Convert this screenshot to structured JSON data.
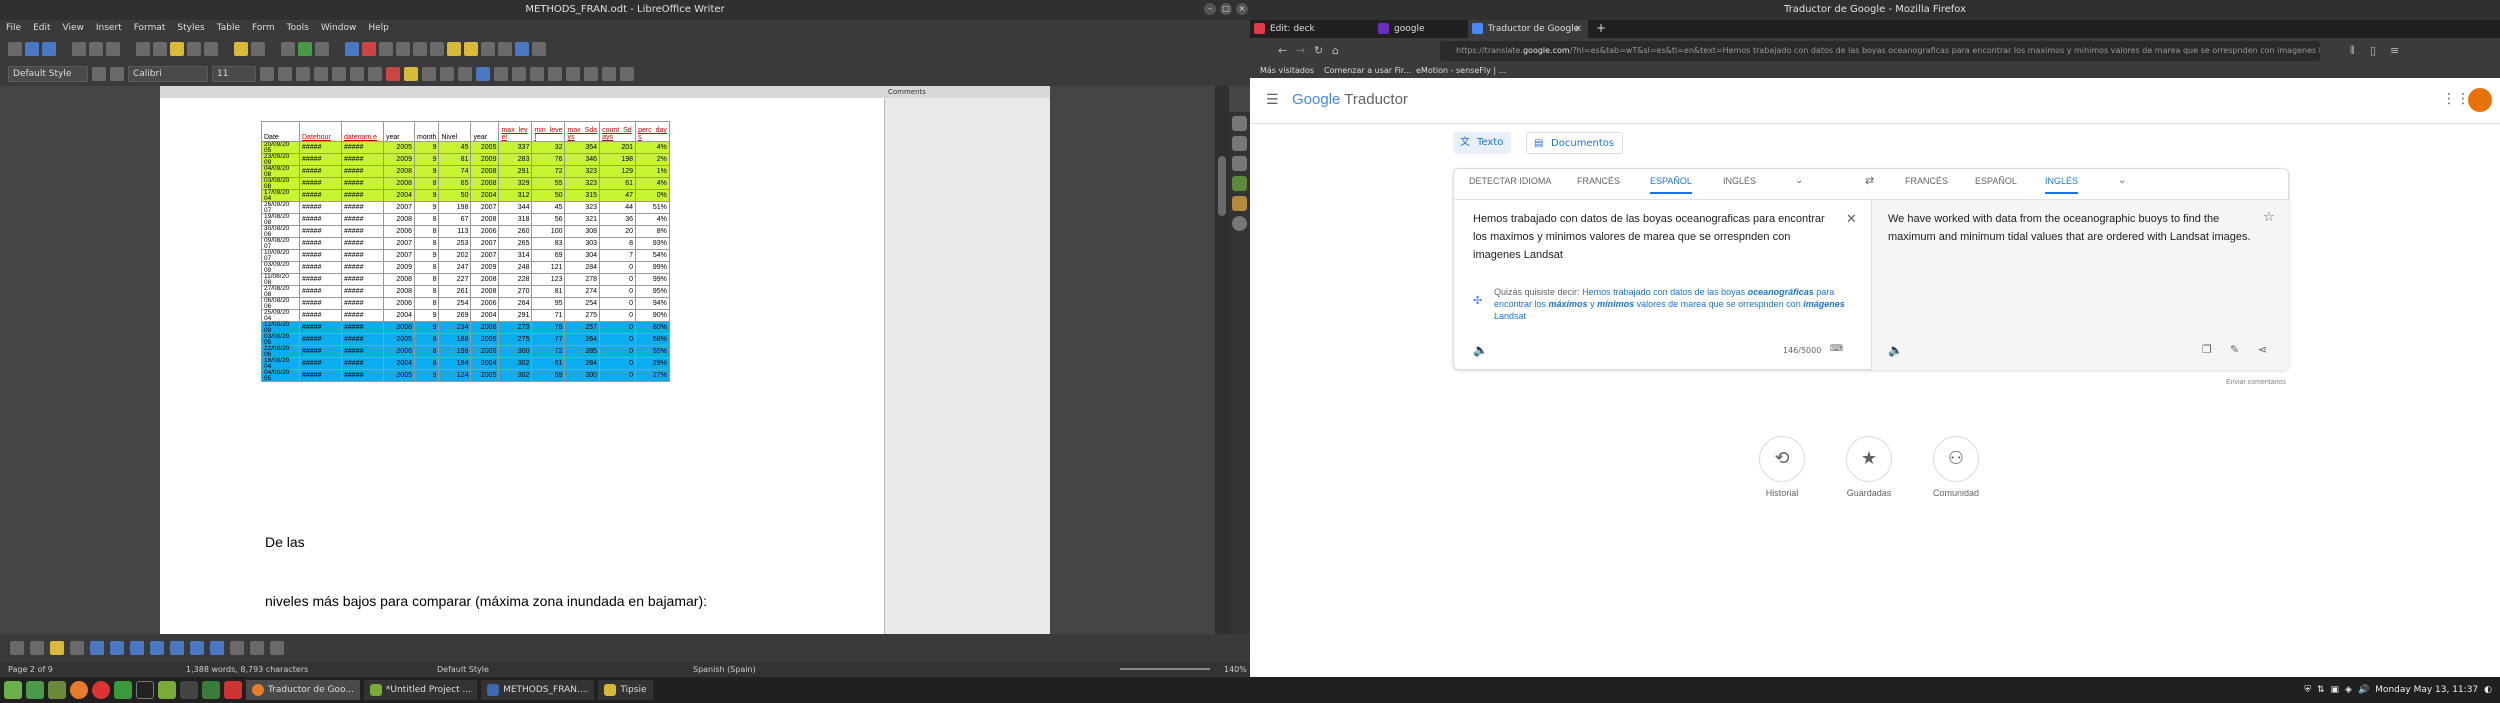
{
  "writer": {
    "title": "METHODS_FRAN.odt - LibreOffice Writer",
    "menu": [
      "File",
      "Edit",
      "View",
      "Insert",
      "Format",
      "Styles",
      "Table",
      "Form",
      "Tools",
      "Window",
      "Help"
    ],
    "para_style": "Default Style",
    "font": "Calibri",
    "size": "11",
    "comments_label": "Comments",
    "table": {
      "headers": [
        "Date",
        "Datehour",
        "datenam e",
        "year",
        "month",
        "Nivel",
        "year",
        "max_lev el",
        "min_leve l",
        "max_Sda ys",
        "count_Sd ays",
        "perc_day s"
      ],
      "header_links": [
        false,
        true,
        true,
        false,
        false,
        false,
        false,
        true,
        true,
        true,
        true,
        true
      ],
      "rows": [
        {
          "c": "g",
          "v": [
            "20/09/20 05",
            "#####",
            "#####",
            "2005",
            "9",
            "45",
            "2005",
            "337",
            "32",
            "354",
            "201",
            "4%"
          ]
        },
        {
          "c": "g",
          "v": [
            "23/09/20 09",
            "#####",
            "#####",
            "2009",
            "9",
            "81",
            "2009",
            "283",
            "76",
            "346",
            "198",
            "2%"
          ]
        },
        {
          "c": "g",
          "v": [
            "04/09/20 08",
            "#####",
            "#####",
            "2008",
            "9",
            "74",
            "2008",
            "291",
            "72",
            "323",
            "129",
            "1%"
          ]
        },
        {
          "c": "g",
          "v": [
            "03/08/20 08",
            "#####",
            "#####",
            "2008",
            "8",
            "65",
            "2008",
            "329",
            "55",
            "323",
            "61",
            "4%"
          ]
        },
        {
          "c": "g",
          "v": [
            "17/09/20 04",
            "#####",
            "#####",
            "2004",
            "9",
            "50",
            "2004",
            "312",
            "50",
            "315",
            "47",
            "0%"
          ]
        },
        {
          "c": "w",
          "v": [
            "26/09/20 07",
            "#####",
            "#####",
            "2007",
            "9",
            "198",
            "2007",
            "344",
            "45",
            "323",
            "44",
            "51%"
          ]
        },
        {
          "c": "w",
          "v": [
            "19/08/20 08",
            "#####",
            "#####",
            "2008",
            "8",
            "67",
            "2008",
            "318",
            "56",
            "321",
            "36",
            "4%"
          ]
        },
        {
          "c": "w",
          "v": [
            "30/08/20 06",
            "#####",
            "#####",
            "2006",
            "8",
            "113",
            "2006",
            "260",
            "100",
            "308",
            "20",
            "8%"
          ]
        },
        {
          "c": "w",
          "v": [
            "09/08/20 07",
            "#####",
            "#####",
            "2007",
            "8",
            "253",
            "2007",
            "265",
            "83",
            "303",
            "8",
            "93%"
          ]
        },
        {
          "c": "w",
          "v": [
            "10/09/20 07",
            "#####",
            "#####",
            "2007",
            "9",
            "202",
            "2007",
            "314",
            "69",
            "304",
            "7",
            "54%"
          ]
        },
        {
          "c": "w",
          "v": [
            "03/09/20 09",
            "#####",
            "#####",
            "2009",
            "8",
            "247",
            "2009",
            "248",
            "121",
            "284",
            "0",
            "99%"
          ]
        },
        {
          "c": "w",
          "v": [
            "11/08/20 08",
            "#####",
            "#####",
            "2008",
            "8",
            "227",
            "2008",
            "228",
            "123",
            "278",
            "0",
            "99%"
          ]
        },
        {
          "c": "w",
          "v": [
            "27/08/20 08",
            "#####",
            "#####",
            "2008",
            "8",
            "261",
            "2008",
            "270",
            "81",
            "274",
            "0",
            "95%"
          ]
        },
        {
          "c": "w",
          "v": [
            "06/08/20 06",
            "#####",
            "#####",
            "2006",
            "8",
            "254",
            "2006",
            "264",
            "95",
            "254",
            "0",
            "94%"
          ]
        },
        {
          "c": "w",
          "v": [
            "25/09/20 04",
            "#####",
            "#####",
            "2004",
            "9",
            "269",
            "2004",
            "291",
            "71",
            "275",
            "0",
            "90%"
          ]
        },
        {
          "c": "b",
          "v": [
            "12/09/20 08",
            "#####",
            "#####",
            "2008",
            "9",
            "234",
            "2008",
            "273",
            "75",
            "257",
            "0",
            "80%"
          ]
        },
        {
          "c": "b",
          "v": [
            "03/08/20 05",
            "#####",
            "#####",
            "2005",
            "8",
            "188",
            "2005",
            "275",
            "77",
            "264",
            "0",
            "58%"
          ]
        },
        {
          "c": "b",
          "v": [
            "22/08/20 06",
            "#####",
            "#####",
            "2006",
            "8",
            "198",
            "2006",
            "300",
            "72",
            "285",
            "0",
            "55%"
          ]
        },
        {
          "c": "b",
          "v": [
            "18/08/20 04",
            "#####",
            "#####",
            "2004",
            "8",
            "194",
            "2004",
            "302",
            "61",
            "284",
            "0",
            "29%"
          ]
        },
        {
          "c": "b",
          "v": [
            "04/09/20 05",
            "#####",
            "#####",
            "2005",
            "9",
            "124",
            "2005",
            "302",
            "59",
            "300",
            "0",
            "27%"
          ]
        }
      ]
    },
    "para1": "De las",
    "para2": "niveles más bajos para comparar (máxima zona inundada en bajamar):",
    "status": {
      "page": "Page 2 of 9",
      "words": "1,388 words, 8,793 characters",
      "style": "Default Style",
      "lang": "Spanish (Spain)",
      "zoom": "140%"
    }
  },
  "firefox": {
    "title": "Traductor de Google - Mozilla Firefox",
    "tabs": [
      {
        "label": "Edit: deck",
        "color": "#e03a4a"
      },
      {
        "label": "google translator - LinuxMint",
        "color": "#6b2fbf"
      },
      {
        "label": "Traductor de Google",
        "color": "#4a8af4"
      }
    ],
    "url_prefix": "https://translate.",
    "url_domain": "google.com",
    "url_rest": "/?hl=es&tab=wT&sl=es&tl=en&text=Hemos trabajado con datos de las boyas oceanograficas para encontrar los maximos y minimos valores de marea que se orrespnden con imagenes Landsat",
    "bookmarks": [
      "Más visitados",
      "Comenzar a usar Fir...",
      "eMotion - senseFly | ..."
    ]
  },
  "translate": {
    "logo": "Google",
    "logo_suffix": "Traductor",
    "mode_text": "Texto",
    "mode_docs": "Documentos",
    "source_langs": [
      "DETECTAR IDIOMA",
      "FRANCÉS",
      "ESPAÑOL",
      "INGLÉS"
    ],
    "target_langs": [
      "FRANCÉS",
      "ESPAÑOL",
      "INGLÉS"
    ],
    "source_text": "Hemos trabajado con datos de las boyas oceanograficas para encontrar los maximos y minimos valores de marea que se orrespnden con imagenes Landsat",
    "suggest_prefix": "Quizás quisiste decir:",
    "suggest_a": "Hemos trabajado con datos de las boyas ",
    "suggest_b": "oceanográficas",
    "suggest_c": " para encontrar los ",
    "suggest_d": "máximos",
    "suggest_e": " y ",
    "suggest_f": "mínimos",
    "suggest_g": " valores de marea que se orrespnden con ",
    "suggest_h": "imágenes",
    "suggest_i": " Landsat",
    "char_count": "146/5000",
    "target_text": "We have worked with data from the oceanographic buoys to find the maximum and minimum tidal values that are ordered with Landsat images.",
    "feedback": "Enviar comentarios",
    "history": "Historial",
    "saved": "Guardadas",
    "community": "Comunidad"
  },
  "taskbar": {
    "windows": [
      "Traductor de Goo...",
      "*Untitled Project ...",
      "METHODS_FRAN....",
      "Tipsie"
    ],
    "clock": "Monday May 13, 11:37"
  }
}
